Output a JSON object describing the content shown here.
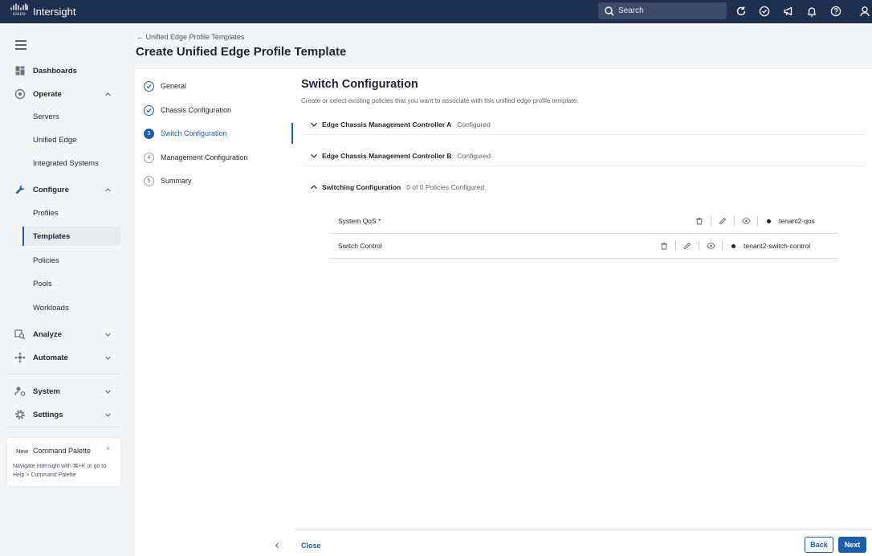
{
  "header": {
    "logo_text": "cisco",
    "app_name": "Intersight",
    "search_placeholder": "Search",
    "icons": [
      "refresh-icon",
      "check-circle-icon",
      "megaphone-icon",
      "bell-icon",
      "help-icon",
      "user-icon"
    ]
  },
  "sidebar": {
    "items": [
      {
        "label": "Dashboards"
      },
      {
        "label": "Operate"
      },
      {
        "label": "Servers"
      },
      {
        "label": "Unified Edge"
      },
      {
        "label": "Integrated Systems"
      },
      {
        "label": "Configure"
      },
      {
        "label": "Profiles"
      },
      {
        "label": "Templates"
      },
      {
        "label": "Policies"
      },
      {
        "label": "Pools"
      },
      {
        "label": "Workloads"
      },
      {
        "label": "Analyze"
      },
      {
        "label": "Automate"
      },
      {
        "label": "System"
      },
      {
        "label": "Settings"
      }
    ],
    "command_palette": {
      "badge": "New",
      "title": "Command Palette",
      "close": "×",
      "desc_pre": "Navigate Intersight with ⌘+K or go to ",
      "desc_link": "Help > Command Palette"
    }
  },
  "page": {
    "back_link": "← Unified Edge Profile Templates",
    "title": "Create Unified Edge Profile Template"
  },
  "steps": [
    {
      "num": "",
      "label": "General"
    },
    {
      "num": "",
      "label": "Chassis Configuration"
    },
    {
      "num": "3",
      "label": "Switch Configuration"
    },
    {
      "num": "4",
      "label": "Management Configuration"
    },
    {
      "num": "5",
      "label": "Summary"
    }
  ],
  "content": {
    "title": "Switch Configuration",
    "subtitle": "Create or select existing policies that you want to associate with this unified edge profile template.",
    "sections": [
      {
        "title": "Edge Chassis Management Controller A",
        "status": "Configured"
      },
      {
        "title": "Edge Chassis Management Controller B",
        "status": "Configured"
      },
      {
        "title": "Switching Configuration",
        "status": "0 of 0 Policies Configured"
      }
    ],
    "policies": [
      {
        "name": "System QoS *",
        "value": "tenant2-qos"
      },
      {
        "name": "Switch Control",
        "value": "tenant2-switch-control"
      }
    ]
  },
  "footer": {
    "close": "Close",
    "back": "Back",
    "next": "Next"
  }
}
